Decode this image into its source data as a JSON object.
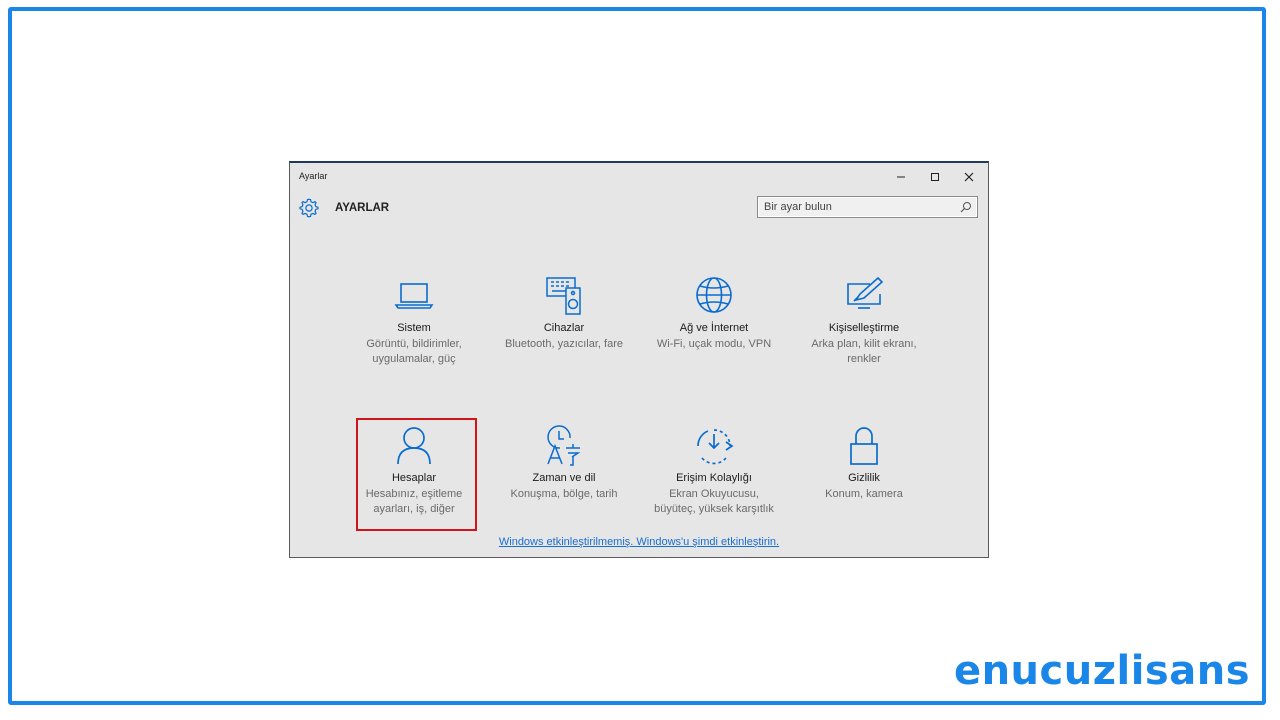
{
  "window": {
    "title": "Ayarlar",
    "header": "AYARLAR",
    "search_placeholder": "Bir ayar bulun"
  },
  "tiles": [
    {
      "name": "Sistem",
      "desc1": "Görüntü, bildirimler,",
      "desc2": "uygulamalar, güç",
      "icon": "laptop-icon"
    },
    {
      "name": "Cihazlar",
      "desc1": "Bluetooth, yazıcılar, fare",
      "desc2": "",
      "icon": "devices-icon"
    },
    {
      "name": "Ağ ve İnternet",
      "desc1": "Wi-Fi, uçak modu, VPN",
      "desc2": "",
      "icon": "globe-icon"
    },
    {
      "name": "Kişiselleştirme",
      "desc1": "Arka plan, kilit ekranı,",
      "desc2": "renkler",
      "icon": "personalize-icon"
    },
    {
      "name": "Hesaplar",
      "desc1": "Hesabınız, eşitleme",
      "desc2": "ayarları, iş, diğer",
      "icon": "person-icon"
    },
    {
      "name": "Zaman ve dil",
      "desc1": "Konuşma, bölge, tarih",
      "desc2": "",
      "icon": "time-language-icon"
    },
    {
      "name": "Erişim Kolaylığı",
      "desc1": "Ekran Okuyucusu,",
      "desc2": "büyüteç, yüksek karşıtlık",
      "icon": "ease-of-access-icon"
    },
    {
      "name": "Gizlilik",
      "desc1": "Konum, kamera",
      "desc2": "",
      "icon": "lock-icon"
    }
  ],
  "activation_link": "Windows etkinleştirilmemiş. Windows'u şimdi etkinleştirin.",
  "brand": "enucuzlisans",
  "colors": {
    "accent": "#0a6ccf",
    "frame": "#1a86e8",
    "highlight": "#d0141c",
    "window_bg": "#e6e6e6"
  }
}
